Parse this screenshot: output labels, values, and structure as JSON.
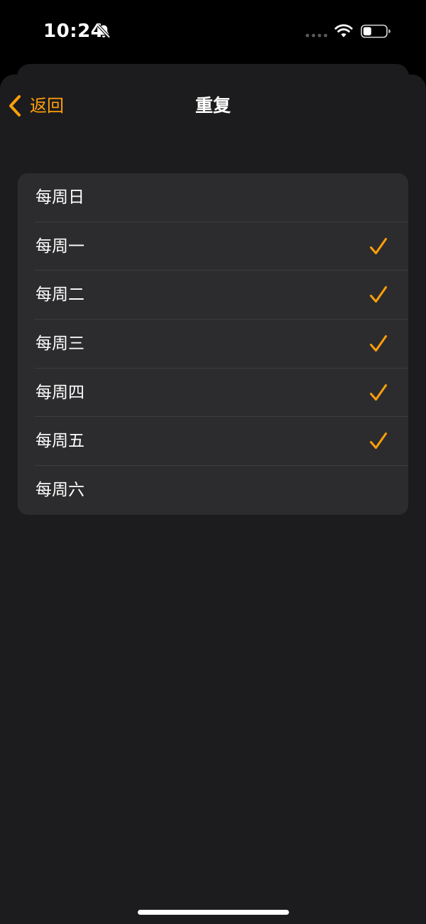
{
  "status_bar": {
    "time": "10:24",
    "icons": [
      "bell-slash-icon",
      "cellular-signal-icon",
      "wifi-icon",
      "battery-icon"
    ]
  },
  "nav": {
    "back_label": "返回",
    "title": "重复"
  },
  "days": [
    {
      "label": "每周日",
      "checked": false
    },
    {
      "label": "每周一",
      "checked": true
    },
    {
      "label": "每周二",
      "checked": true
    },
    {
      "label": "每周三",
      "checked": true
    },
    {
      "label": "每周四",
      "checked": true
    },
    {
      "label": "每周五",
      "checked": true
    },
    {
      "label": "每周六",
      "checked": false
    }
  ],
  "colors": {
    "accent": "#ff9f0a",
    "background": "#1c1c1e",
    "card": "#2c2c2e",
    "text": "#ffffff"
  }
}
